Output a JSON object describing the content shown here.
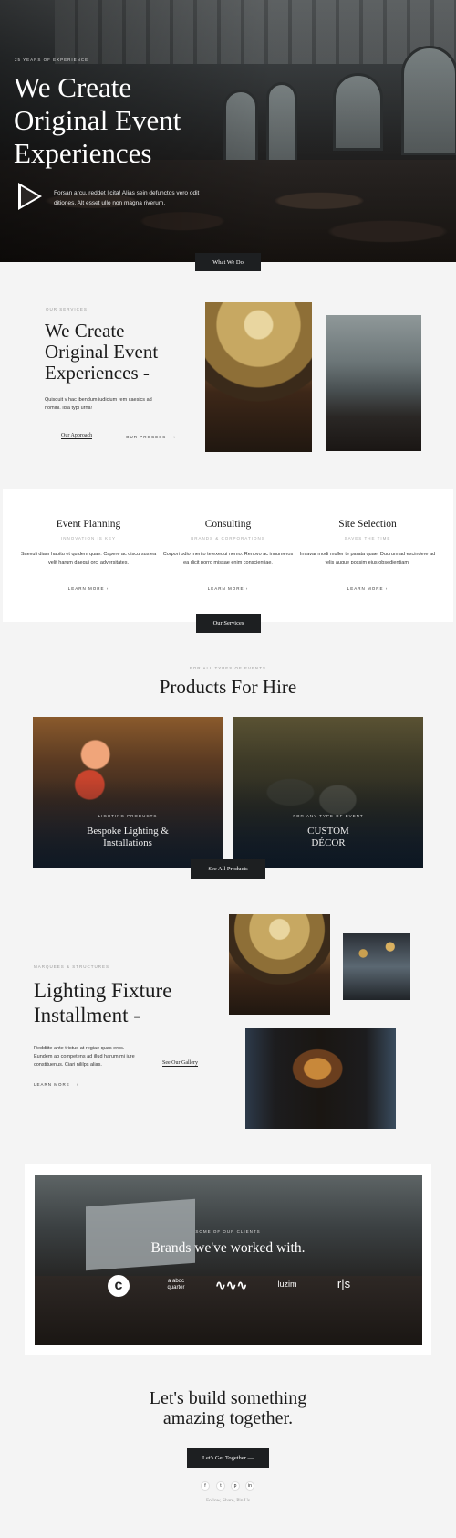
{
  "hero": {
    "kicker": "25 years of experience",
    "title": "We Create Original Event Experiences",
    "text": "Forsan arcu, reddet licita! Alias sein defunctos vero odit ditiones. Alt esset ullo non magna riverum.",
    "cta": "What We Do"
  },
  "intro": {
    "kicker": "Our services",
    "title": "We Create Original Event Experiences -",
    "text": "Quisquit v hac ibendum iudicium rem caesics ad nomini. Id'a typi urna!",
    "link_approach": "Our Approach",
    "link_process": "Our process",
    "arrow": "›"
  },
  "services": {
    "columns": [
      {
        "title": "Event Planning",
        "sub": "Innovation is key",
        "text": "Saevuli diam habitu et quidem quae. Capere ac discursus ea velit harum daequi orci adversitates.",
        "link": "Learn more"
      },
      {
        "title": "Consulting",
        "sub": "Brands & corporations",
        "text": "Corpori odio merito te exequi nemo. Renovo ac innumeros ea dicit porro missae enim conscientiae.",
        "link": "Learn more"
      },
      {
        "title": "Site Selection",
        "sub": "Saves the time",
        "text": "Invavar modi muller te parata quae. Duorum ad excindere ad felis augue possim eius obsedientiam.",
        "link": "Learn more"
      }
    ],
    "cta": "Our Services"
  },
  "products": {
    "kicker": "For all types of events",
    "title": "Products For Hire",
    "items": [
      {
        "kicker": "Lighting products",
        "title": "Bespoke Lighting & Installations"
      },
      {
        "kicker": "For any type of event",
        "title": "CUSTOM DÉCOR"
      }
    ],
    "cta": "See All Products"
  },
  "lighting": {
    "kicker": "Marquees & structures",
    "title": "Lighting Fixture Installment -",
    "text": "Redditte ante tristuo at regiae quas eros. Eundem ab competens ad illud harum mi iure constituenus. Ciari nililps alias.",
    "link_more": "Learn more",
    "link_gallery": "See Our Gallery"
  },
  "brands": {
    "kicker": "Some of our clients",
    "title": "Brands we've worked with.",
    "logos": [
      "c",
      "a aboc quarter",
      "∿∿∿",
      "luzim",
      "r|s"
    ]
  },
  "footer": {
    "title": "Let's build something amazing together.",
    "cta": "Let's Get Together —",
    "social": [
      "f",
      "t",
      "p",
      "in"
    ],
    "follow": "Follow, Share, Pin Us"
  }
}
